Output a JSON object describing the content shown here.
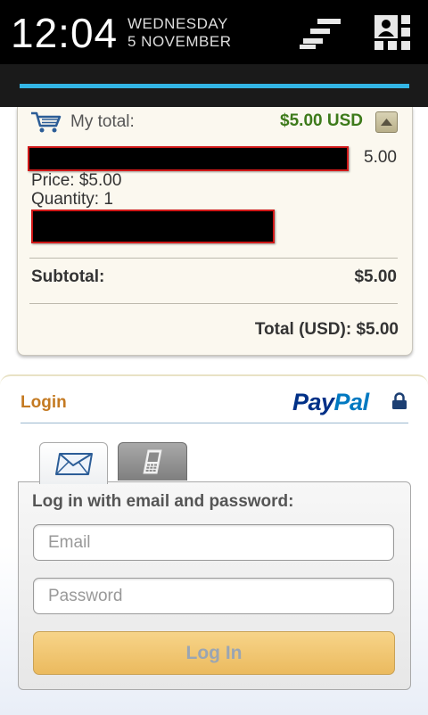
{
  "status_bar": {
    "time": "12:04",
    "day": "WEDNESDAY",
    "date": "5 NOVEMBER",
    "icons": [
      "settings-icon",
      "profile-icon"
    ]
  },
  "cart": {
    "my_total_label": "My total:",
    "my_total_value": "$5.00 USD",
    "item": {
      "amount": "5.00",
      "price_label": "Price: $5.00",
      "quantity_label": "Quantity: 1"
    },
    "subtotal_label": "Subtotal:",
    "subtotal_value": "$5.00",
    "total_line": "Total (USD): $5.00"
  },
  "login": {
    "title": "Login",
    "brand_pay": "Pay",
    "brand_pal": "Pal",
    "tabs": [
      {
        "icon": "envelope-icon",
        "selected": true
      },
      {
        "icon": "mobile-phone-icon",
        "selected": false
      }
    ],
    "form_heading": "Log in with email and password:",
    "email_placeholder": "Email",
    "password_placeholder": "Password",
    "button_label": "Log In"
  },
  "colors": {
    "total_green": "#3d7a1a",
    "login_orange": "#c47a22",
    "paypal_dark": "#003087",
    "paypal_light": "#0079c1",
    "loading_blue": "#33b5e5"
  }
}
